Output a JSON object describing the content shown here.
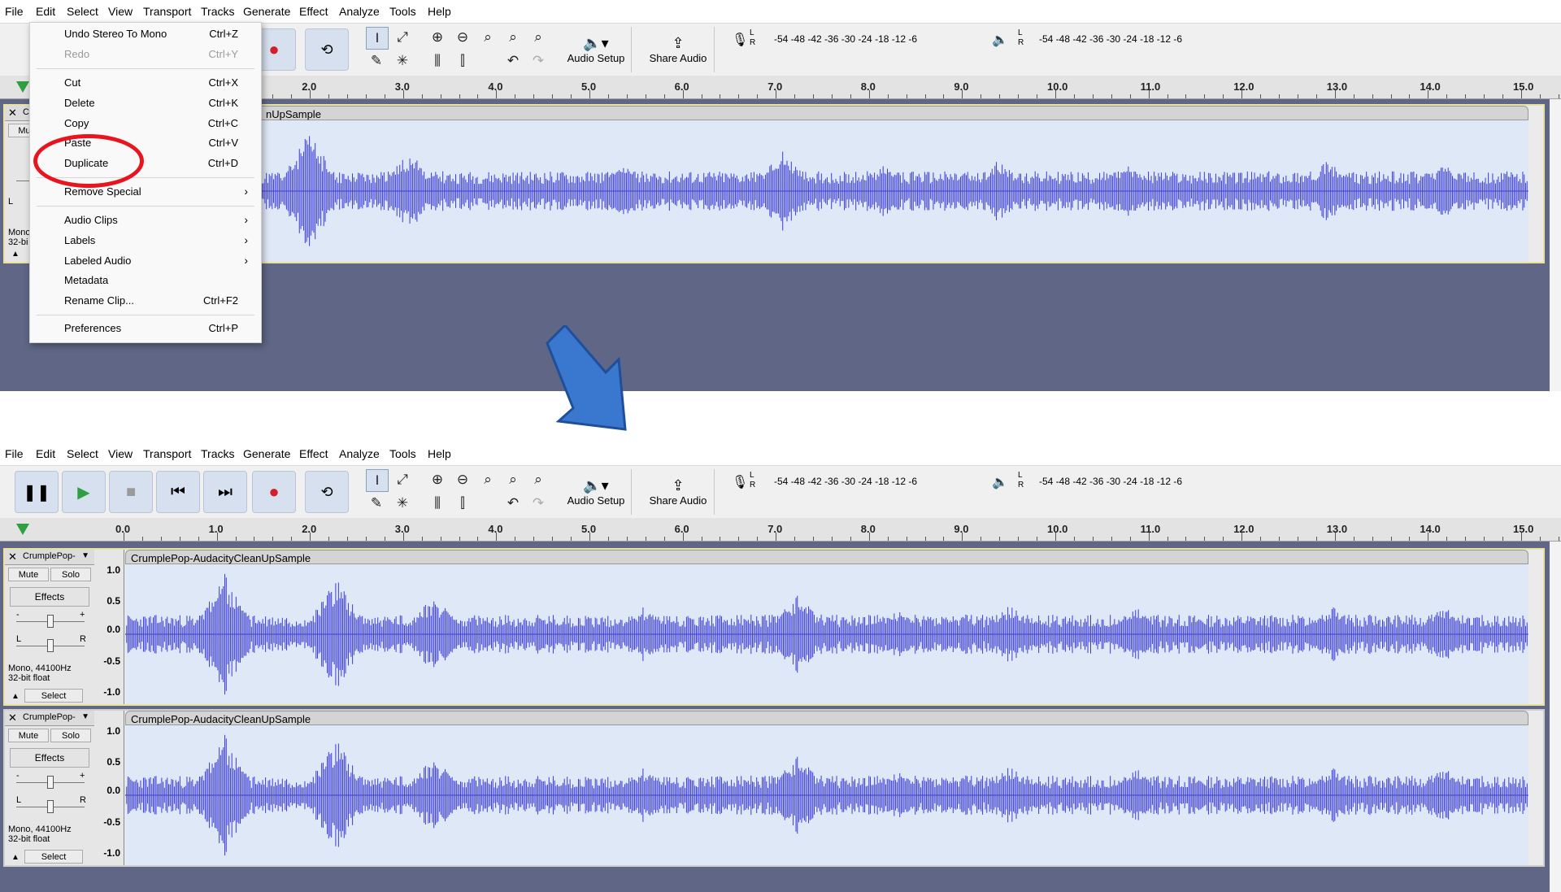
{
  "menubar": [
    "File",
    "Edit",
    "Select",
    "View",
    "Transport",
    "Tracks",
    "Generate",
    "Effect",
    "Analyze",
    "Tools",
    "Help"
  ],
  "toolbar": {
    "audio_setup": "Audio Setup",
    "share_audio": "Share Audio",
    "meter_scale": "-54  -48  -42  -36  -30  -24  -18  -12   -6",
    "meter_l": "L",
    "meter_r": "R"
  },
  "ruler": [
    "0.0",
    "1.0",
    "2.0",
    "3.0",
    "4.0",
    "5.0",
    "6.0",
    "7.0",
    "8.0",
    "9.0",
    "10.0",
    "11.0",
    "12.0",
    "13.0",
    "14.0",
    "15.0"
  ],
  "edit_menu": {
    "items": [
      {
        "label": "Undo Stereo To Mono",
        "shortcut": "Ctrl+Z"
      },
      {
        "label": "Redo",
        "shortcut": "Ctrl+Y",
        "disabled": true
      },
      {
        "label": "Cut",
        "shortcut": "Ctrl+X"
      },
      {
        "label": "Delete",
        "shortcut": "Ctrl+K"
      },
      {
        "label": "Copy",
        "shortcut": "Ctrl+C"
      },
      {
        "label": "Paste",
        "shortcut": "Ctrl+V"
      },
      {
        "label": "Duplicate",
        "shortcut": "Ctrl+D",
        "highlighted": true
      },
      {
        "label": "Remove Special",
        "submenu": true
      },
      {
        "label": "Audio Clips",
        "submenu": true
      },
      {
        "label": "Labels",
        "submenu": true
      },
      {
        "label": "Labeled Audio",
        "submenu": true
      },
      {
        "label": "Metadata"
      },
      {
        "label": "Rename Clip...",
        "shortcut": "Ctrl+F2"
      },
      {
        "label": "Preferences",
        "shortcut": "Ctrl+P"
      }
    ]
  },
  "top_panel": {
    "clip_name_visible": "nUpSample",
    "track": {
      "name": "C",
      "mute": "Mu",
      "info1": "Mono",
      "info2": "32-bi",
      "l": "L"
    }
  },
  "track": {
    "name": "CrumplePop-",
    "clip_name": "CrumplePop-AudacityCleanUpSample",
    "mute": "Mute",
    "solo": "Solo",
    "effects": "Effects",
    "gain_minus": "-",
    "gain_plus": "+",
    "pan_l": "L",
    "pan_r": "R",
    "info_rate": "Mono, 44100Hz",
    "info_format": "32-bit float",
    "select": "Select",
    "vruler": [
      "1.0",
      "0.5",
      "0.0",
      "-0.5",
      "-1.0"
    ]
  },
  "colors": {
    "waveform": "#3b3bd8",
    "highlight_circle": "#e8141e",
    "arrow": "#3a78d0",
    "track_bg": "#5f6686"
  }
}
